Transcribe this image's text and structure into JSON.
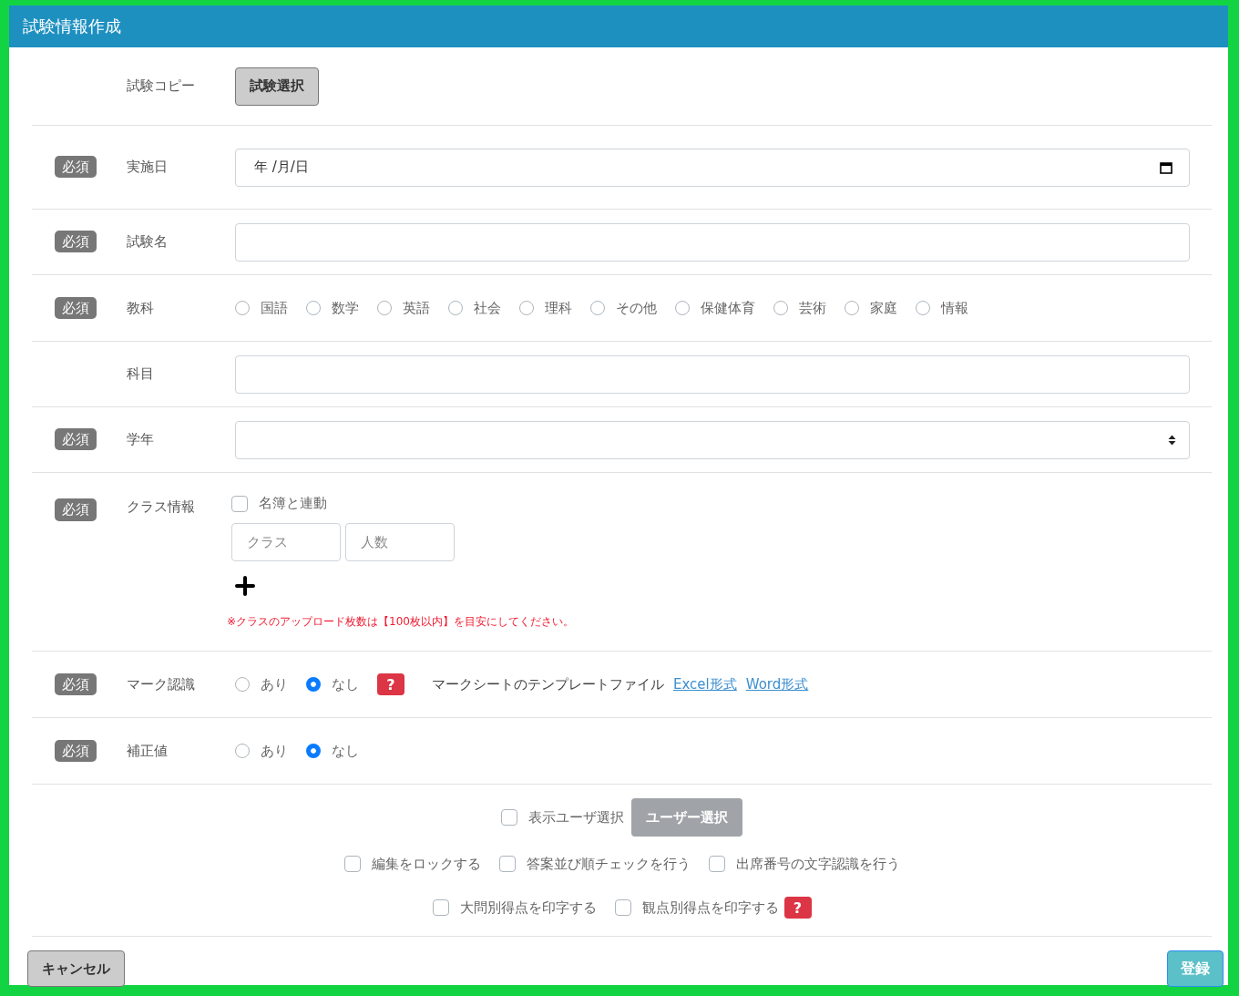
{
  "window": {
    "title": "試験情報作成"
  },
  "rows": [
    {
      "kind": "button",
      "label": "試験コピー",
      "button": "試験選択"
    },
    {
      "kind": "date",
      "badge": "必須",
      "label": "実施日",
      "value": "年 /月/日"
    },
    {
      "kind": "text",
      "badge": "必須",
      "label": "試験名"
    },
    {
      "kind": "radio",
      "badge": "必須",
      "label": "教科",
      "options": [
        {
          "label": "国語",
          "selected": false
        },
        {
          "label": "数学",
          "selected": false
        },
        {
          "label": "英語",
          "selected": false
        },
        {
          "label": "社会",
          "selected": false
        },
        {
          "label": "理科",
          "selected": false
        },
        {
          "label": "その他",
          "selected": false
        },
        {
          "label": "保健体育",
          "selected": false
        },
        {
          "label": "芸術",
          "selected": false
        },
        {
          "label": "家庭",
          "selected": false
        },
        {
          "label": "情報",
          "selected": false
        }
      ]
    },
    {
      "kind": "text",
      "label": "科目"
    },
    {
      "kind": "select",
      "badge": "必須",
      "label": "学年"
    },
    {
      "kind": "class",
      "badge": "必須",
      "label": "クラス情報",
      "link_checkbox": {
        "label": "名簿と連動",
        "checked": false
      },
      "fields": [
        {
          "placeholder": "クラス"
        },
        {
          "placeholder": "人数"
        }
      ],
      "note": "※クラスのアップロード枚数は【100枚以内】を目安にしてください。"
    },
    {
      "kind": "radio",
      "badge": "必須",
      "label": "マーク認識",
      "options": [
        {
          "label": "あり",
          "selected": false
        },
        {
          "label": "なし",
          "selected": true
        }
      ],
      "help": "?",
      "template_text": "マークシートのテンプレートファイル",
      "links": [
        "Excel形式",
        "Word形式"
      ]
    },
    {
      "kind": "radio",
      "badge": "必須",
      "label": "補正値",
      "options": [
        {
          "label": "あり",
          "selected": false
        },
        {
          "label": "なし",
          "selected": true
        }
      ]
    }
  ],
  "options_section": {
    "user_select": {
      "label": "表示ユーザ選択",
      "checked": false,
      "button": "ユーザー選択"
    },
    "checkbox_rows": [
      [
        {
          "label": "編集をロックする",
          "checked": false
        },
        {
          "label": "答案並び順チェックを行う",
          "checked": false
        },
        {
          "label": "出席番号の文字認識を行う",
          "checked": false
        }
      ],
      [
        {
          "label": "大問別得点を印字する",
          "checked": false
        },
        {
          "label": "観点別得点を印字する",
          "checked": false,
          "help": "?"
        }
      ]
    ]
  },
  "footer": {
    "cancel": "キャンセル",
    "submit": "登録"
  }
}
